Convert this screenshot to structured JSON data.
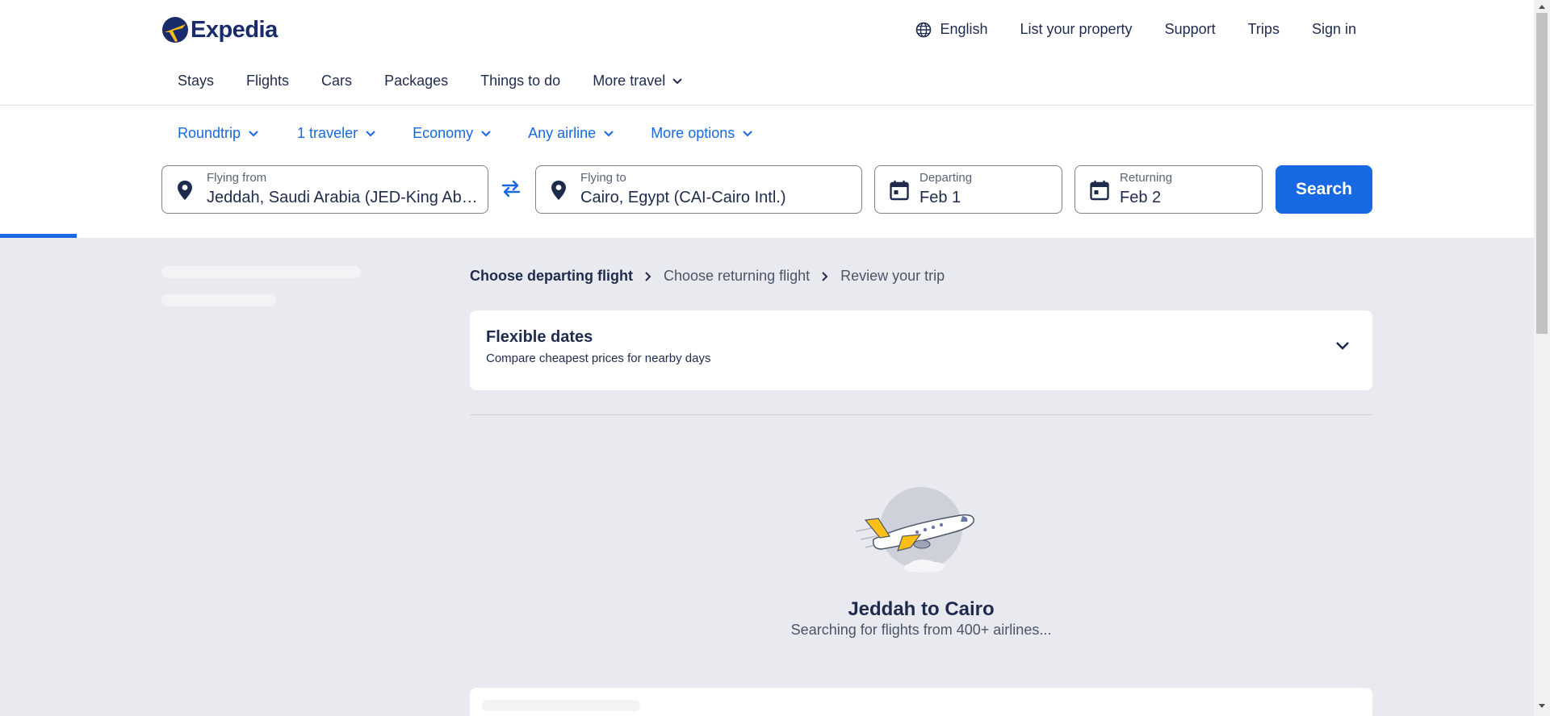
{
  "brand": {
    "name": "Expedia",
    "colors": {
      "primary": "#1668e3",
      "navy": "#1a2b6b",
      "logo_yellow": "#fdbf16",
      "page_bg": "#e9eaef"
    }
  },
  "topnav": {
    "language": "English",
    "list_property": "List your property",
    "support": "Support",
    "trips": "Trips",
    "sign_in": "Sign in"
  },
  "mainnav": {
    "items": [
      "Stays",
      "Flights",
      "Cars",
      "Packages",
      "Things to do"
    ],
    "more": "More travel"
  },
  "search_options": {
    "trip_type": "Roundtrip",
    "travelers": "1 traveler",
    "cabin": "Economy",
    "airline": "Any airline",
    "more": "More options"
  },
  "search_form": {
    "from": {
      "label": "Flying from",
      "value": "Jeddah, Saudi Arabia (JED-King Abdulaziz Intl.)"
    },
    "to": {
      "label": "Flying to",
      "value": "Cairo, Egypt (CAI-Cairo Intl.)"
    },
    "departing": {
      "label": "Departing",
      "value": "Feb 1"
    },
    "returning": {
      "label": "Returning",
      "value": "Feb 2"
    },
    "search_button": "Search"
  },
  "breadcrumb": {
    "step1": "Choose departing flight",
    "step2": "Choose returning flight",
    "step3": "Review your trip"
  },
  "flexible_dates": {
    "title": "Flexible dates",
    "subtitle": "Compare cheapest prices for nearby days"
  },
  "loading": {
    "title": "Jeddah to Cairo",
    "subtitle": "Searching for flights from 400+ airlines..."
  },
  "icons": [
    "globe-icon",
    "chevron-down-icon",
    "map-pin-icon",
    "swap-icon",
    "calendar-icon",
    "chevron-right-icon",
    "airplane-illustration"
  ]
}
